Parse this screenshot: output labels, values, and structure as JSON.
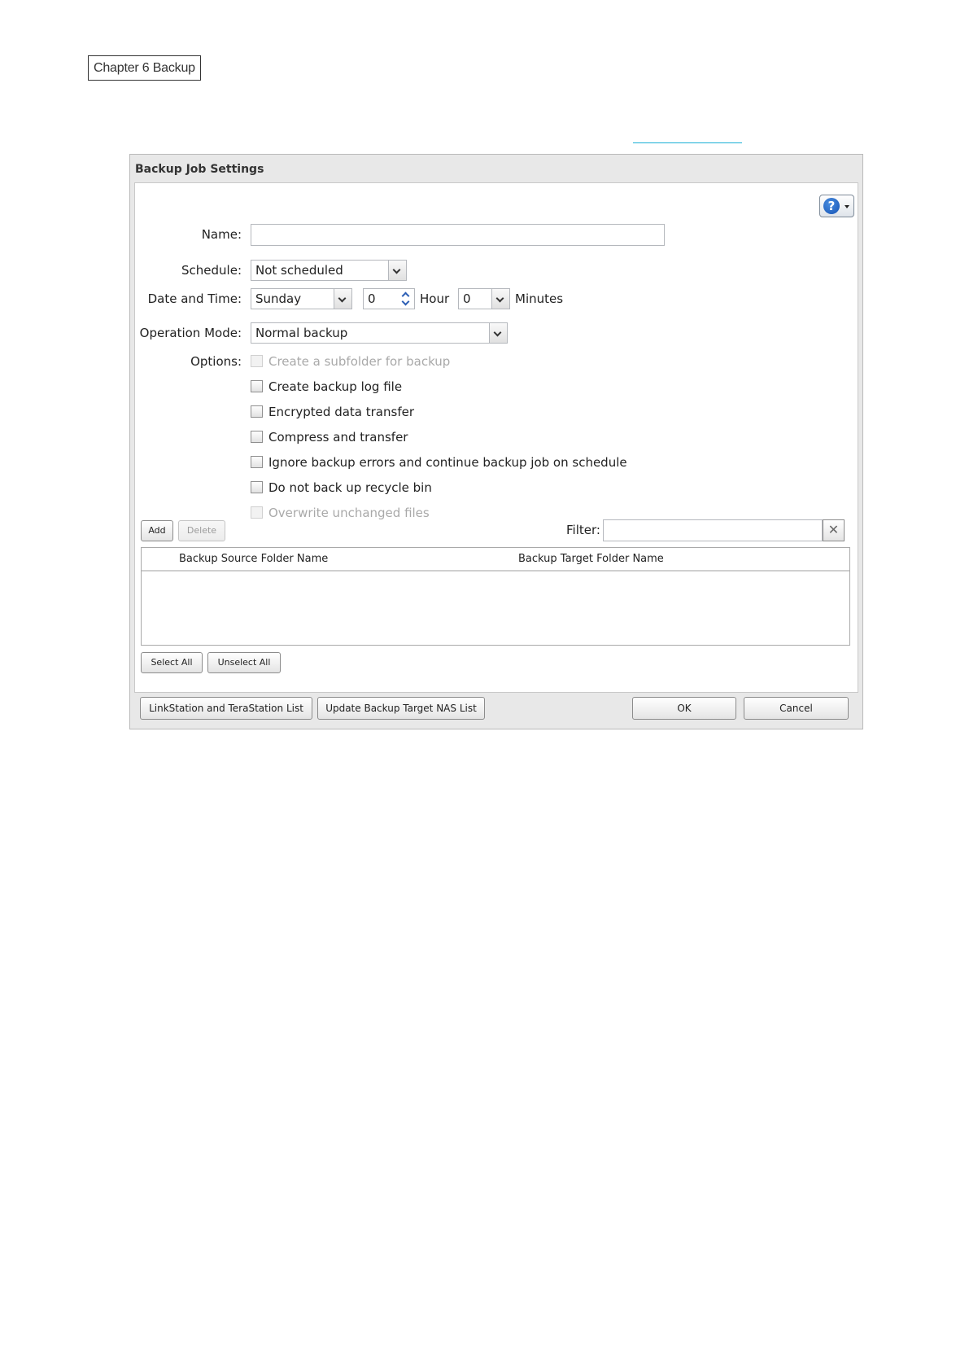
{
  "header": {
    "chapter": "Chapter 6 Backup"
  },
  "dialog": {
    "title": "Backup Job Settings",
    "help_symbol": "?",
    "form": {
      "name_label": "Name:",
      "name_value": "",
      "schedule_label": "Schedule:",
      "schedule_value": "Not scheduled",
      "datetime_label": "Date and Time:",
      "day_value": "Sunday",
      "hour_value": "0",
      "hour_label": "Hour",
      "minutes_value": "0",
      "minutes_label": "Minutes",
      "operation_mode_label": "Operation Mode:",
      "operation_mode_value": "Normal backup",
      "options_label": "Options:",
      "options": [
        {
          "label": "Create a subfolder for backup",
          "checked": false,
          "disabled": true
        },
        {
          "label": "Create backup log file",
          "checked": false,
          "disabled": false
        },
        {
          "label": "Encrypted data transfer",
          "checked": false,
          "disabled": false
        },
        {
          "label": "Compress and transfer",
          "checked": false,
          "disabled": false
        },
        {
          "label": "Ignore backup errors and continue backup job on schedule",
          "checked": false,
          "disabled": false
        },
        {
          "label": "Do not back up recycle bin",
          "checked": false,
          "disabled": false
        },
        {
          "label": "Overwrite unchanged files",
          "checked": false,
          "disabled": true
        }
      ]
    },
    "toolbar": {
      "add_label": "Add",
      "delete_label": "Delete",
      "filter_label": "Filter:",
      "filter_value": "",
      "clear_symbol": "✕"
    },
    "table": {
      "columns": [
        "Backup Source Folder Name",
        "Backup Target Folder Name"
      ],
      "rows": []
    },
    "selection": {
      "select_all_label": "Select All",
      "unselect_all_label": "Unselect All"
    },
    "footer": {
      "nas_list_label": "LinkStation and TeraStation List",
      "update_list_label": "Update Backup Target NAS List",
      "ok_label": "OK",
      "cancel_label": "Cancel"
    }
  }
}
